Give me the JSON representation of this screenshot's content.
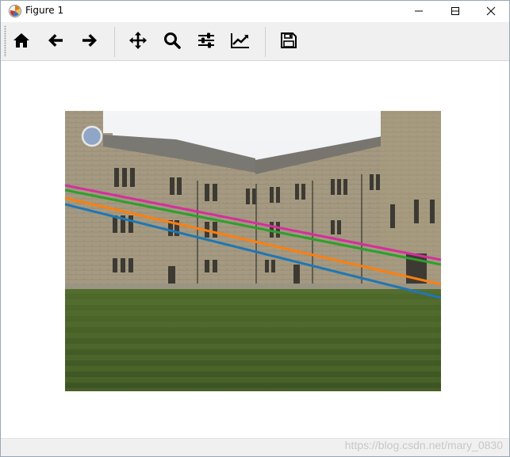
{
  "window": {
    "title": "Figure 1",
    "controls": {
      "minimize_icon": "minimize-icon",
      "maximize_icon": "maximize-icon",
      "close_icon": "close-icon"
    }
  },
  "toolbar": {
    "buttons": [
      {
        "name": "home",
        "icon": "home-icon"
      },
      {
        "name": "back",
        "icon": "arrow-left-icon"
      },
      {
        "name": "forward",
        "icon": "arrow-right-icon"
      },
      {
        "name": "pan",
        "icon": "move-icon"
      },
      {
        "name": "zoom",
        "icon": "magnifier-icon"
      },
      {
        "name": "configure-subplots",
        "icon": "sliders-icon"
      },
      {
        "name": "edit-axes",
        "icon": "trend-chart-icon"
      },
      {
        "name": "save",
        "icon": "floppy-disk-icon"
      }
    ]
  },
  "figure": {
    "image_subject": "college quadrangle with stone buildings and lawn",
    "line_colors": [
      "#d62e9e",
      "#2ca02c",
      "#ff7f0e",
      "#1f77b4"
    ]
  },
  "status": {
    "watermark": "https://blog.csdn.net/mary_0830"
  }
}
